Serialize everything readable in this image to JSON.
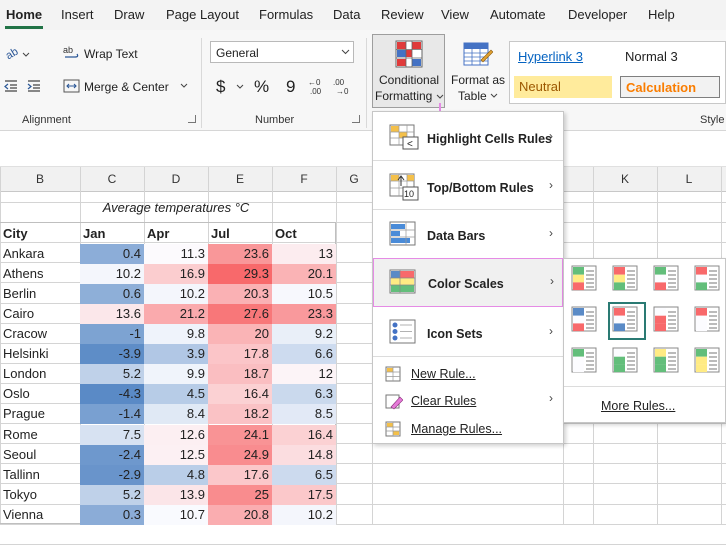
{
  "tabs": [
    "Home",
    "Insert",
    "Draw",
    "Page Layout",
    "Formulas",
    "Data",
    "Review",
    "View",
    "Automate",
    "Developer",
    "Help"
  ],
  "ribbon": {
    "alignment": {
      "wrap_text": "Wrap Text",
      "merge_center": "Merge & Center",
      "label": "Alignment"
    },
    "number": {
      "format_value": "General",
      "currency": "$",
      "percent": "%",
      "comma": "9",
      "label": "Number"
    },
    "conditional_formatting": {
      "line1": "Conditional",
      "line2": "Formatting"
    },
    "format_as_table": {
      "line1": "Format as",
      "line2": "Table"
    },
    "styles": {
      "hyperlink3": "Hyperlink 3",
      "normal3": "Normal 3",
      "neutral": "Neutral",
      "calculation": "Calculation",
      "label": "Style"
    }
  },
  "columns": [
    "B",
    "C",
    "D",
    "E",
    "F",
    "G",
    "K",
    "L"
  ],
  "sheet": {
    "title": "Average temperatures °C",
    "headers": [
      "City",
      "Jan",
      "Apr",
      "Jul",
      "Oct"
    ],
    "rows": [
      {
        "city": "Ankara",
        "jan": "0.4",
        "apr": "11.3",
        "jul": "23.6",
        "oct": "13"
      },
      {
        "city": "Athens",
        "jan": "10.2",
        "apr": "16.9",
        "jul": "29.3",
        "oct": "20.1"
      },
      {
        "city": "Berlin",
        "jan": "0.6",
        "apr": "10.2",
        "jul": "20.3",
        "oct": "10.5"
      },
      {
        "city": "Cairo",
        "jan": "13.6",
        "apr": "21.2",
        "jul": "27.6",
        "oct": "23.3"
      },
      {
        "city": "Cracow",
        "jan": "-1",
        "apr": "9.8",
        "jul": "20",
        "oct": "9.2"
      },
      {
        "city": "Helsinki",
        "jan": "-3.9",
        "apr": "3.9",
        "jul": "17.8",
        "oct": "6.6"
      },
      {
        "city": "London",
        "jan": "5.2",
        "apr": "9.9",
        "jul": "18.7",
        "oct": "12"
      },
      {
        "city": "Oslo",
        "jan": "-4.3",
        "apr": "4.5",
        "jul": "16.4",
        "oct": "6.3"
      },
      {
        "city": "Prague",
        "jan": "-1.4",
        "apr": "8.4",
        "jul": "18.2",
        "oct": "8.5"
      },
      {
        "city": "Rome",
        "jan": "7.5",
        "apr": "12.6",
        "jul": "24.1",
        "oct": "16.4"
      },
      {
        "city": "Seoul",
        "jan": "-2.4",
        "apr": "12.5",
        "jul": "24.9",
        "oct": "14.8"
      },
      {
        "city": "Tallinn",
        "jan": "-2.9",
        "apr": "4.8",
        "jul": "17.6",
        "oct": "6.5"
      },
      {
        "city": "Tokyo",
        "jan": "5.2",
        "apr": "13.9",
        "jul": "25",
        "oct": "17.5"
      },
      {
        "city": "Vienna",
        "jan": "0.3",
        "apr": "10.7",
        "jul": "20.8",
        "oct": "10.2"
      }
    ]
  },
  "menu": {
    "items": [
      "Highlight Cells Rules",
      "Top/Bottom Rules",
      "Data Bars",
      "Color Scales",
      "Icon Sets"
    ],
    "small_items": [
      "New Rule...",
      "Clear Rules",
      "Manage Rules..."
    ]
  },
  "submenu": {
    "more_rules": "More Rules..."
  },
  "colors": {
    "accent_green": "#217346",
    "highlight_magenta": "#e58be5",
    "blue_scale": "#5a8ac6",
    "red_scale": "#f8696b"
  }
}
